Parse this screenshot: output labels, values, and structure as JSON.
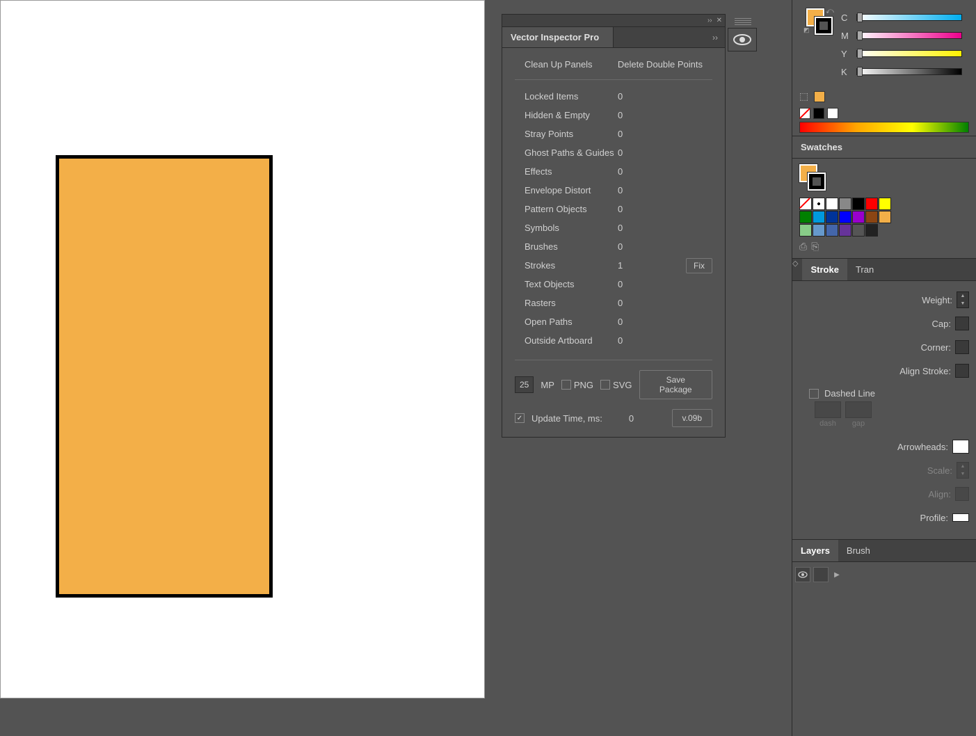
{
  "canvas": {
    "rect_fill": "#f3af48",
    "rect_stroke": "#000000"
  },
  "inspector": {
    "title": "Vector Inspector Pro",
    "actions": {
      "clean": "Clean Up Panels",
      "delete": "Delete Double Points"
    },
    "items": [
      {
        "label": "Locked Items",
        "value": "0",
        "fix": false
      },
      {
        "label": "Hidden & Empty",
        "value": "0",
        "fix": false
      },
      {
        "label": "Stray Points",
        "value": "0",
        "fix": false
      },
      {
        "label": "Ghost Paths & Guides",
        "value": "0",
        "fix": false
      },
      {
        "label": "Effects",
        "value": "0",
        "fix": false
      },
      {
        "label": "Envelope Distort",
        "value": "0",
        "fix": false
      },
      {
        "label": "Pattern Objects",
        "value": "0",
        "fix": false
      },
      {
        "label": "Symbols",
        "value": "0",
        "fix": false
      },
      {
        "label": "Brushes",
        "value": "0",
        "fix": false
      },
      {
        "label": "Strokes",
        "value": "1",
        "fix": true
      },
      {
        "label": "Text Objects",
        "value": "0",
        "fix": false
      },
      {
        "label": "Rasters",
        "value": "0",
        "fix": false
      },
      {
        "label": "Open Paths",
        "value": "0",
        "fix": false
      },
      {
        "label": "Outside Artboard",
        "value": "0",
        "fix": false
      }
    ],
    "fix_label": "Fix",
    "footer": {
      "mp_value": "25",
      "mp_label": "MP",
      "png_label": "PNG",
      "svg_label": "SVG",
      "save_label": "Save Package",
      "update_label": "Update Time, ms:",
      "update_value": "0",
      "version": "v.09b"
    }
  },
  "color_panel": {
    "channels": [
      "C",
      "M",
      "Y",
      "K"
    ]
  },
  "swatches": {
    "title": "Swatches",
    "colors": [
      "#ffffff",
      "#888888",
      "#000000",
      "#ff0000",
      "#ffff00",
      "#008000",
      "#0099dd",
      "#003399",
      "#0000ff",
      "#9900cc",
      "#8b4513",
      "#f3af48",
      "#88cc88",
      "#6699cc",
      "#4466aa",
      "#663399",
      "#555555",
      "#222222"
    ]
  },
  "stroke_panel": {
    "tab_stroke": "Stroke",
    "tab_transparency": "Tran",
    "weight_label": "Weight:",
    "cap_label": "Cap:",
    "corner_label": "Corner:",
    "align_label": "Align Stroke:",
    "dashed_label": "Dashed Line",
    "dash_label": "dash",
    "gap_label": "gap",
    "arrowheads_label": "Arrowheads:",
    "scale_label": "Scale:",
    "align2_label": "Align:",
    "profile_label": "Profile:"
  },
  "layers_panel": {
    "tab_layers": "Layers",
    "tab_brushes": "Brush"
  }
}
